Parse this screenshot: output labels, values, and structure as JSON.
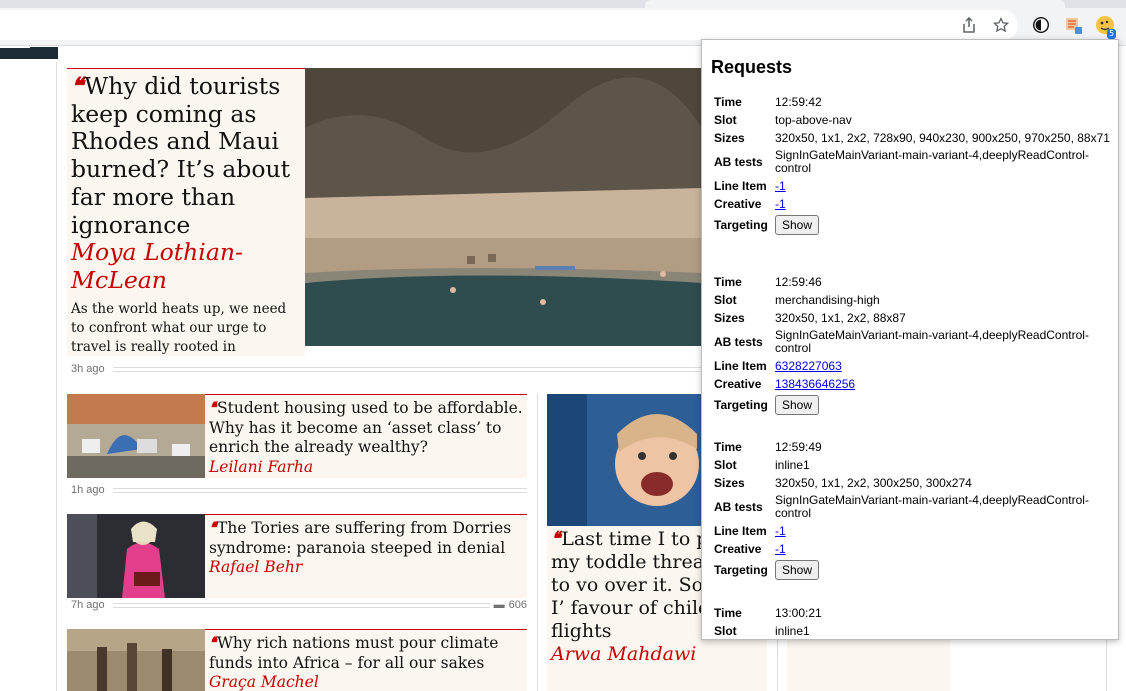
{
  "browser": {
    "icons": [
      "share-icon",
      "star-icon",
      "contrast-extension-icon",
      "notes-extension-icon",
      "cookie-extension-icon"
    ],
    "extension_badge_count": "5"
  },
  "articles": {
    "main": {
      "headline": "Why did tourists keep coming as Rhodes and Maui burned? It’s about far more than ignorance",
      "byline": "Moya Lothian-McLean",
      "standfirst": "As the world heats up, we need to confront what our urge to travel is really rooted in",
      "age": "3h ago"
    },
    "item1": {
      "headline": "Student housing used to be affordable. Why has it become an ‘asset class’ to enrich the already wealthy?",
      "byline": "Leilani Farha",
      "age": "1h ago"
    },
    "item2": {
      "headline": "The Tories are suffering from Dorries syndrome: paranoia steeped in denial",
      "byline": "Rafael Behr",
      "age": "7h ago",
      "comments": "606"
    },
    "item3": {
      "headline": "Why rich nations must pour climate funds into Africa – for all our sakes",
      "byline": "Graça Machel"
    },
    "item4": {
      "headline": "Last time I took a plane, my toddler threatened to vomit all over it. So, yes, I’m in favour of child-free flights",
      "headline_visible": "Last time I to plane, my toddle threatened to vo over it. So, yes, I’ favour of child-fr flights",
      "byline": "Arwa Mahdawi"
    }
  },
  "popup": {
    "title": "Requests",
    "labels": {
      "time": "Time",
      "slot": "Slot",
      "sizes": "Sizes",
      "ab_tests": "AB tests",
      "line_item": "Line Item",
      "creative": "Creative",
      "targeting": "Targeting",
      "show": "Show"
    },
    "requests": [
      {
        "time": "12:59:42",
        "slot": "top-above-nav",
        "sizes": "320x50, 1x1, 2x2, 728x90, 940x230, 900x250, 970x250, 88x71",
        "ab_tests": "SignInGateMainVariant-main-variant-4,deeplyReadControl-control",
        "line_item": "-1",
        "creative": "-1"
      },
      {
        "time": "12:59:46",
        "slot": "merchandising-high",
        "sizes": "320x50, 1x1, 2x2, 88x87",
        "ab_tests": "SignInGateMainVariant-main-variant-4,deeplyReadControl-control",
        "line_item": "6328227063",
        "creative": "138436646256"
      },
      {
        "time": "12:59:49",
        "slot": "inline1",
        "sizes": "320x50, 1x1, 2x2, 300x250, 300x274",
        "ab_tests": "SignInGateMainVariant-main-variant-4,deeplyReadControl-control",
        "line_item": "-1",
        "creative": "-1"
      },
      {
        "time": "13:00:21",
        "slot": "inline1"
      }
    ]
  }
}
